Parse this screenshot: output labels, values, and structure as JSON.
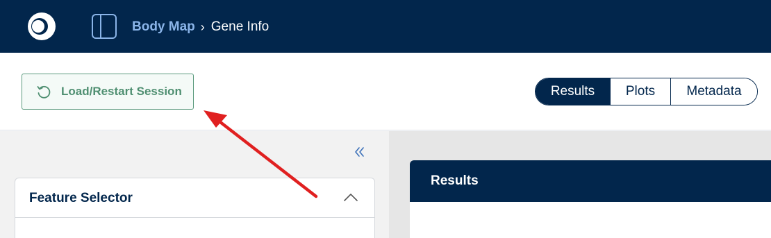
{
  "navbar": {
    "breadcrumb": {
      "parent": "Body Map",
      "separator": "›",
      "current": "Gene Info"
    }
  },
  "toolbar": {
    "load_button_label": "Load/Restart Session",
    "view_tabs": [
      {
        "label": "Results",
        "active": true
      },
      {
        "label": "Plots",
        "active": false
      },
      {
        "label": "Metadata",
        "active": false
      }
    ]
  },
  "left_panel": {
    "feature_selector_title": "Feature Selector"
  },
  "right_panel": {
    "results_title": "Results"
  },
  "colors": {
    "navy": "#02264c",
    "link_blue": "#8ab4e8",
    "green_accent": "#4f8f71",
    "annotation_red": "#e02020"
  },
  "icons": {
    "logo": "app-logo-icon",
    "sidebar_toggle": "sidebar-toggle-icon",
    "restart": "restart-icon",
    "collapse": "double-chevron-left-icon",
    "expand_toggle": "chevron-up-icon"
  }
}
